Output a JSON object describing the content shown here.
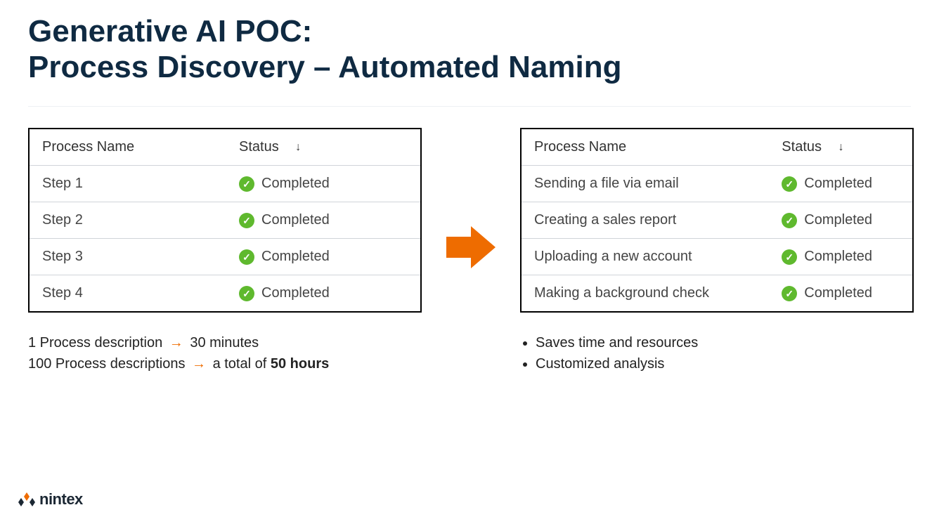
{
  "title_line1": "Generative AI POC:",
  "title_line2": "Process Discovery – Automated Naming",
  "headers": {
    "process_name": "Process Name",
    "status": "Status"
  },
  "status_label": "Completed",
  "left_table": [
    "Step 1",
    "Step 2",
    "Step 3",
    "Step 4"
  ],
  "right_table": [
    "Sending a file via email",
    "Creating a sales report",
    "Uploading a new account",
    "Making a background check"
  ],
  "left_notes": {
    "line1_a": "1 Process description ",
    "line1_b": " 30 minutes",
    "line2_a": "100 Process descriptions ",
    "line2_b": " a total of ",
    "line2_bold": "50 hours"
  },
  "right_bullets": [
    "Saves time and resources",
    "Customized analysis"
  ],
  "logo_text": "nintex"
}
